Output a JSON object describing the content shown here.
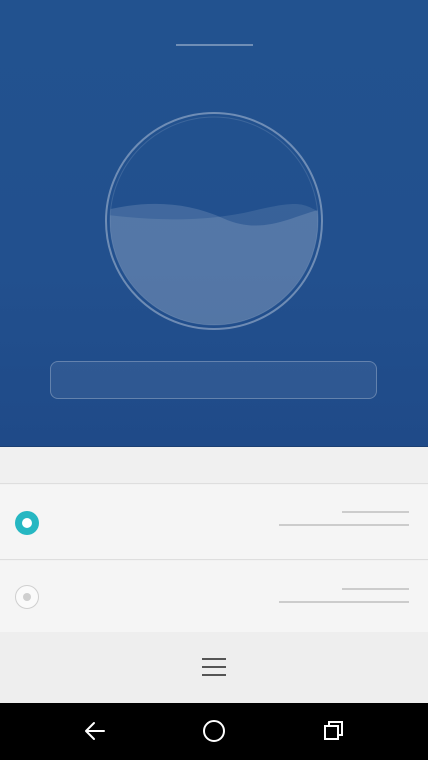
{
  "hero": {
    "title": "",
    "gauge_value_label": "",
    "fill_level": 0.55,
    "action_label": ""
  },
  "section": {
    "header": ""
  },
  "options": [
    {
      "label": "",
      "value": "",
      "selected": true
    },
    {
      "label": "",
      "value": "",
      "selected": false
    }
  ],
  "bottom_bar": {
    "menu_icon": "hamburger-menu-icon"
  },
  "navbar": {
    "back_icon": "back-arrow-icon",
    "home_icon": "home-circle-icon",
    "recents_icon": "recents-squares-icon"
  },
  "colors": {
    "hero_bg": "#22528f",
    "accent": "#26b7c2",
    "navbar_bg": "#000000"
  }
}
